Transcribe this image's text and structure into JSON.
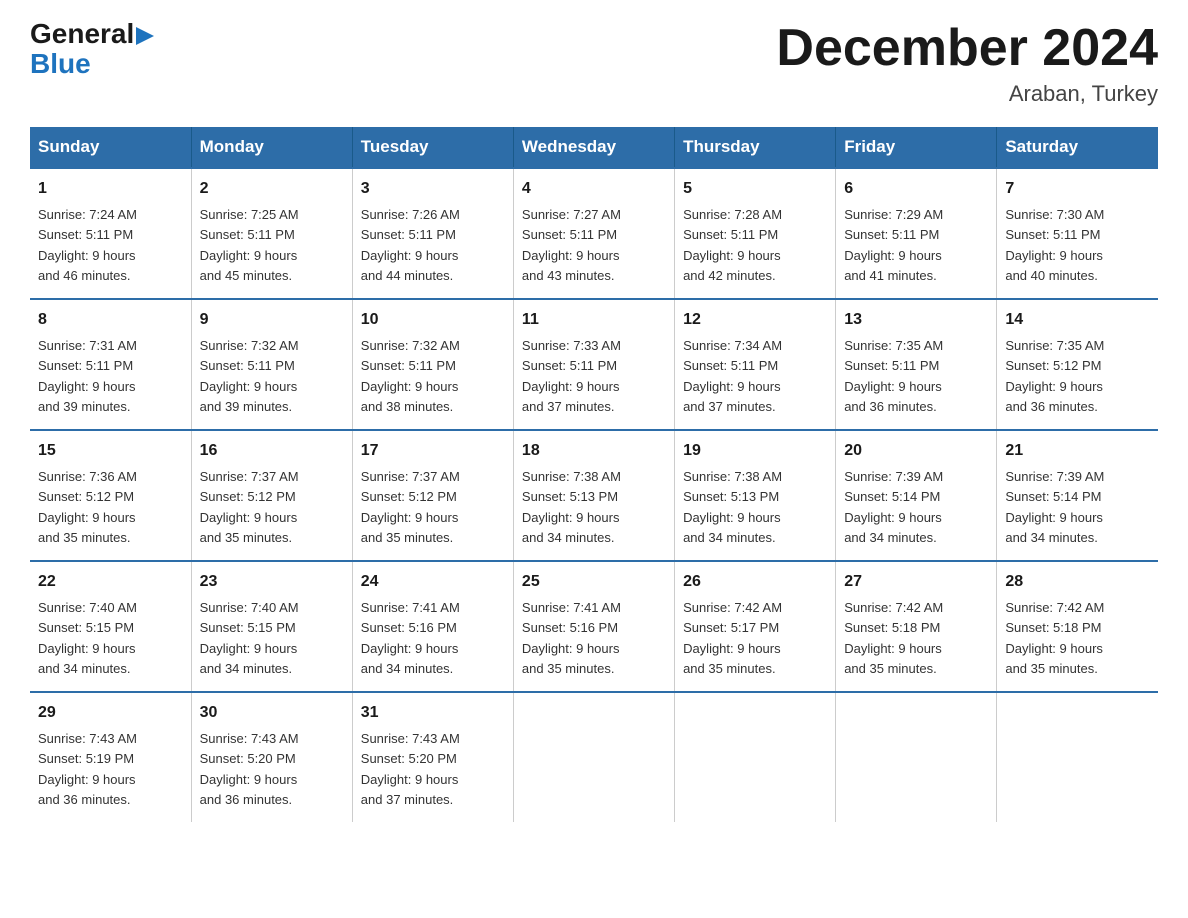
{
  "logo": {
    "general": "General",
    "blue": "Blue"
  },
  "header": {
    "month_title": "December 2024",
    "location": "Araban, Turkey"
  },
  "weekdays": [
    "Sunday",
    "Monday",
    "Tuesday",
    "Wednesday",
    "Thursday",
    "Friday",
    "Saturday"
  ],
  "weeks": [
    [
      {
        "day": "1",
        "sunrise": "7:24 AM",
        "sunset": "5:11 PM",
        "daylight": "9 hours and 46 minutes."
      },
      {
        "day": "2",
        "sunrise": "7:25 AM",
        "sunset": "5:11 PM",
        "daylight": "9 hours and 45 minutes."
      },
      {
        "day": "3",
        "sunrise": "7:26 AM",
        "sunset": "5:11 PM",
        "daylight": "9 hours and 44 minutes."
      },
      {
        "day": "4",
        "sunrise": "7:27 AM",
        "sunset": "5:11 PM",
        "daylight": "9 hours and 43 minutes."
      },
      {
        "day": "5",
        "sunrise": "7:28 AM",
        "sunset": "5:11 PM",
        "daylight": "9 hours and 42 minutes."
      },
      {
        "day": "6",
        "sunrise": "7:29 AM",
        "sunset": "5:11 PM",
        "daylight": "9 hours and 41 minutes."
      },
      {
        "day": "7",
        "sunrise": "7:30 AM",
        "sunset": "5:11 PM",
        "daylight": "9 hours and 40 minutes."
      }
    ],
    [
      {
        "day": "8",
        "sunrise": "7:31 AM",
        "sunset": "5:11 PM",
        "daylight": "9 hours and 39 minutes."
      },
      {
        "day": "9",
        "sunrise": "7:32 AM",
        "sunset": "5:11 PM",
        "daylight": "9 hours and 39 minutes."
      },
      {
        "day": "10",
        "sunrise": "7:32 AM",
        "sunset": "5:11 PM",
        "daylight": "9 hours and 38 minutes."
      },
      {
        "day": "11",
        "sunrise": "7:33 AM",
        "sunset": "5:11 PM",
        "daylight": "9 hours and 37 minutes."
      },
      {
        "day": "12",
        "sunrise": "7:34 AM",
        "sunset": "5:11 PM",
        "daylight": "9 hours and 37 minutes."
      },
      {
        "day": "13",
        "sunrise": "7:35 AM",
        "sunset": "5:11 PM",
        "daylight": "9 hours and 36 minutes."
      },
      {
        "day": "14",
        "sunrise": "7:35 AM",
        "sunset": "5:12 PM",
        "daylight": "9 hours and 36 minutes."
      }
    ],
    [
      {
        "day": "15",
        "sunrise": "7:36 AM",
        "sunset": "5:12 PM",
        "daylight": "9 hours and 35 minutes."
      },
      {
        "day": "16",
        "sunrise": "7:37 AM",
        "sunset": "5:12 PM",
        "daylight": "9 hours and 35 minutes."
      },
      {
        "day": "17",
        "sunrise": "7:37 AM",
        "sunset": "5:12 PM",
        "daylight": "9 hours and 35 minutes."
      },
      {
        "day": "18",
        "sunrise": "7:38 AM",
        "sunset": "5:13 PM",
        "daylight": "9 hours and 34 minutes."
      },
      {
        "day": "19",
        "sunrise": "7:38 AM",
        "sunset": "5:13 PM",
        "daylight": "9 hours and 34 minutes."
      },
      {
        "day": "20",
        "sunrise": "7:39 AM",
        "sunset": "5:14 PM",
        "daylight": "9 hours and 34 minutes."
      },
      {
        "day": "21",
        "sunrise": "7:39 AM",
        "sunset": "5:14 PM",
        "daylight": "9 hours and 34 minutes."
      }
    ],
    [
      {
        "day": "22",
        "sunrise": "7:40 AM",
        "sunset": "5:15 PM",
        "daylight": "9 hours and 34 minutes."
      },
      {
        "day": "23",
        "sunrise": "7:40 AM",
        "sunset": "5:15 PM",
        "daylight": "9 hours and 34 minutes."
      },
      {
        "day": "24",
        "sunrise": "7:41 AM",
        "sunset": "5:16 PM",
        "daylight": "9 hours and 34 minutes."
      },
      {
        "day": "25",
        "sunrise": "7:41 AM",
        "sunset": "5:16 PM",
        "daylight": "9 hours and 35 minutes."
      },
      {
        "day": "26",
        "sunrise": "7:42 AM",
        "sunset": "5:17 PM",
        "daylight": "9 hours and 35 minutes."
      },
      {
        "day": "27",
        "sunrise": "7:42 AM",
        "sunset": "5:18 PM",
        "daylight": "9 hours and 35 minutes."
      },
      {
        "day": "28",
        "sunrise": "7:42 AM",
        "sunset": "5:18 PM",
        "daylight": "9 hours and 35 minutes."
      }
    ],
    [
      {
        "day": "29",
        "sunrise": "7:43 AM",
        "sunset": "5:19 PM",
        "daylight": "9 hours and 36 minutes."
      },
      {
        "day": "30",
        "sunrise": "7:43 AM",
        "sunset": "5:20 PM",
        "daylight": "9 hours and 36 minutes."
      },
      {
        "day": "31",
        "sunrise": "7:43 AM",
        "sunset": "5:20 PM",
        "daylight": "9 hours and 37 minutes."
      },
      null,
      null,
      null,
      null
    ]
  ],
  "labels": {
    "sunrise": "Sunrise: ",
    "sunset": "Sunset: ",
    "daylight": "Daylight: "
  }
}
